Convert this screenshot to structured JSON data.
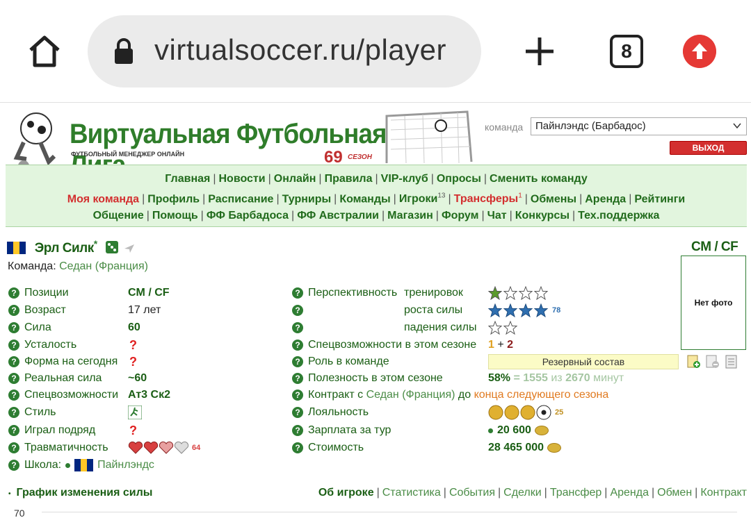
{
  "browser": {
    "url": "virtualsoccer.ru/player",
    "tab_count": "8"
  },
  "site": {
    "logo_title": "Виртуальная Футбольная Лига",
    "logo_subtitle": "ФУТБОЛЬНЫЙ МЕНЕДЖЕР ОНЛАЙН",
    "season_num": "69",
    "season_word": "СЕЗОН"
  },
  "team_select": {
    "label": "команда",
    "value": "Пайнлэндс (Барбадос)"
  },
  "exit_label": "ВЫХОД",
  "nav": {
    "row1": [
      "Главная",
      "Новости",
      "Онлайн",
      "Правила",
      "VIP-клуб",
      "Опросы",
      "Сменить команду"
    ],
    "row2": [
      {
        "t": "Моя команда",
        "red": true
      },
      {
        "t": "Профиль"
      },
      {
        "t": "Расписание"
      },
      {
        "t": "Турниры"
      },
      {
        "t": "Команды"
      },
      {
        "t": "Игроки",
        "sup": "13"
      },
      {
        "t": "Трансферы",
        "sup": "1",
        "red": true
      },
      {
        "t": "Обмены"
      },
      {
        "t": "Аренда"
      },
      {
        "t": "Рейтинги"
      }
    ],
    "row3": [
      "Общение",
      "Помощь",
      "ФФ Барбадоса",
      "ФФ Австралии",
      "Магазин",
      "Форум",
      "Чат",
      "Конкурсы",
      "Тех.поддержка"
    ]
  },
  "player": {
    "name": "Эрл Силк",
    "star": "*",
    "position": "CM / CF",
    "no_photo": "Нет фото",
    "team_label": "Команда:",
    "team": "Седан (Франция)"
  },
  "left": [
    {
      "label": "Позиции",
      "value": "CM / CF"
    },
    {
      "label": "Возраст",
      "value": "17 лет"
    },
    {
      "label": "Сила",
      "value": "60"
    },
    {
      "label": "Усталость",
      "value": "?"
    },
    {
      "label": "Форма на сегодня",
      "value": "?"
    },
    {
      "label": "Реальная сила",
      "value": "~60"
    },
    {
      "label": "Спецвозможности",
      "value": "Ат3 Ск2"
    },
    {
      "label": "Стиль",
      "value": ""
    },
    {
      "label": "Играл подряд",
      "value": "?"
    },
    {
      "label": "Травматичность",
      "value": "64"
    }
  ],
  "school": {
    "label": "Школа:",
    "value": "Пайнлэндс"
  },
  "right": {
    "persp": "Перспективность",
    "training": "тренировок",
    "growth": "роста силы",
    "growth_num": "78",
    "decline": "падения силы",
    "special": "Спецвозможности в этом сезоне",
    "special_a": "1",
    "special_plus": "+",
    "special_b": "2",
    "role": "Роль в команде",
    "role_value": "Резервный состав",
    "useful": "Полезность в этом сезоне",
    "useful_pct": "58%",
    "useful_eq": "=",
    "useful_a": "1555",
    "useful_of": "из",
    "useful_b": "2670",
    "useful_min": "минут",
    "contract": "Контракт с",
    "contract_team": "Седан (Франция)",
    "contract_to": "до",
    "contract_end": "конца следующего сезона",
    "loyalty": "Лояльность",
    "loyalty_num": "25",
    "salary": "Зарплата за тур",
    "salary_val": "20 600",
    "cost": "Стоимость",
    "cost_val": "28 465 000"
  },
  "graph": {
    "title": "График изменения силы",
    "y_top": "70"
  },
  "tabs": [
    {
      "t": "Об игроке",
      "b": true
    },
    {
      "t": "Статистика"
    },
    {
      "t": "События"
    },
    {
      "t": "Сделки"
    },
    {
      "t": "Трансфер"
    },
    {
      "t": "Аренда"
    },
    {
      "t": "Обмен"
    },
    {
      "t": "Контракт"
    }
  ],
  "colors": {
    "green": "#1a5e14",
    "red": "#d32f2f",
    "nav_bg": "#e2f5de"
  }
}
